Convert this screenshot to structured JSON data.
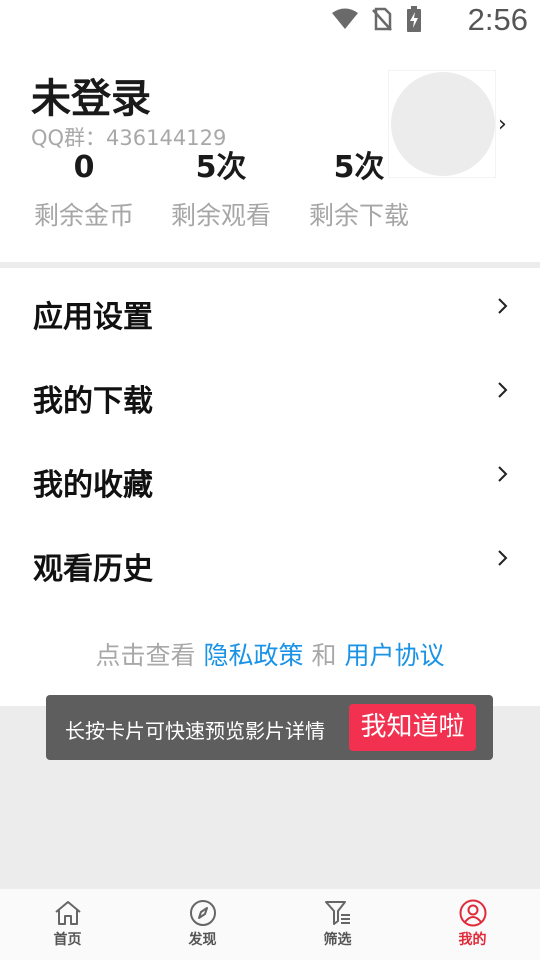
{
  "status_bar": {
    "time": "2:56",
    "icons": [
      "wifi-icon",
      "no-sim-icon",
      "battery-charging-icon"
    ]
  },
  "profile": {
    "username": "未登录",
    "qq_group": "QQ群：436144129",
    "stats": [
      {
        "value": "0",
        "label": "剩余金币"
      },
      {
        "value": "5次",
        "label": "剩余观看"
      },
      {
        "value": "5次",
        "label": "剩余下载"
      }
    ],
    "chevron": "›"
  },
  "menu": [
    {
      "label": "应用设置"
    },
    {
      "label": "我的下载"
    },
    {
      "label": "我的收藏"
    },
    {
      "label": "观看历史"
    }
  ],
  "policy": {
    "prefix": "点击查看",
    "privacy": "隐私政策",
    "and": "和",
    "agreement": "用户协议"
  },
  "toast": {
    "message": "长按卡片可快速预览影片详情",
    "button": "我知道啦"
  },
  "tabs": [
    {
      "label": "首页",
      "icon": "home-icon",
      "active": false
    },
    {
      "label": "发现",
      "icon": "compass-icon",
      "active": false
    },
    {
      "label": "筛选",
      "icon": "filter-icon",
      "active": false
    },
    {
      "label": "我的",
      "icon": "user-icon",
      "active": true
    }
  ],
  "colors": {
    "accent": "#e02a3a",
    "link": "#1a93e6",
    "toast_button": "#f2304f",
    "toast_bg": "#5e5e5e"
  }
}
